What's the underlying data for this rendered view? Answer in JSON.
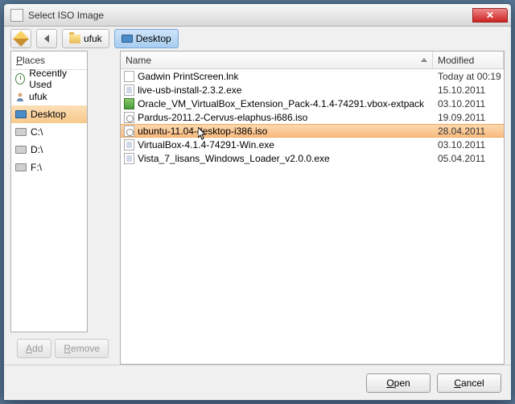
{
  "window": {
    "title": "Select ISO Image"
  },
  "breadcrumb": {
    "user": "ufuk",
    "location": "Desktop"
  },
  "sidebar": {
    "header": "Places",
    "add": "Add",
    "remove": "Remove",
    "items": [
      {
        "icon": "clock",
        "label": "Recently Used"
      },
      {
        "icon": "person",
        "label": "ufuk"
      },
      {
        "icon": "monitor",
        "label": "Desktop",
        "selected": true
      },
      {
        "icon": "drive",
        "label": "C:\\"
      },
      {
        "icon": "drive",
        "label": "D:\\"
      },
      {
        "icon": "drive",
        "label": "F:\\"
      }
    ]
  },
  "columns": {
    "name": "Name",
    "modified": "Modified"
  },
  "files": [
    {
      "icon": "file",
      "name": "Gadwin PrintScreen.lnk",
      "modified": "Today at 00:19"
    },
    {
      "icon": "exe",
      "name": "live-usb-install-2.3.2.exe",
      "modified": "15.10.2011"
    },
    {
      "icon": "pack",
      "name": "Oracle_VM_VirtualBox_Extension_Pack-4.1.4-74291.vbox-extpack",
      "modified": "03.10.2011"
    },
    {
      "icon": "iso",
      "name": "Pardus-2011.2-Cervus-elaphus-i686.iso",
      "modified": "19.09.2011"
    },
    {
      "icon": "iso",
      "name": "ubuntu-11.04-desktop-i386.iso",
      "modified": "28.04.2011",
      "selected": true
    },
    {
      "icon": "exe",
      "name": "VirtualBox-4.1.4-74291-Win.exe",
      "modified": "03.10.2011"
    },
    {
      "icon": "exe",
      "name": "Vista_7_lisans_Windows_Loader_v2.0.0.exe",
      "modified": "05.04.2011"
    }
  ],
  "buttons": {
    "open": "Open",
    "cancel": "Cancel"
  }
}
